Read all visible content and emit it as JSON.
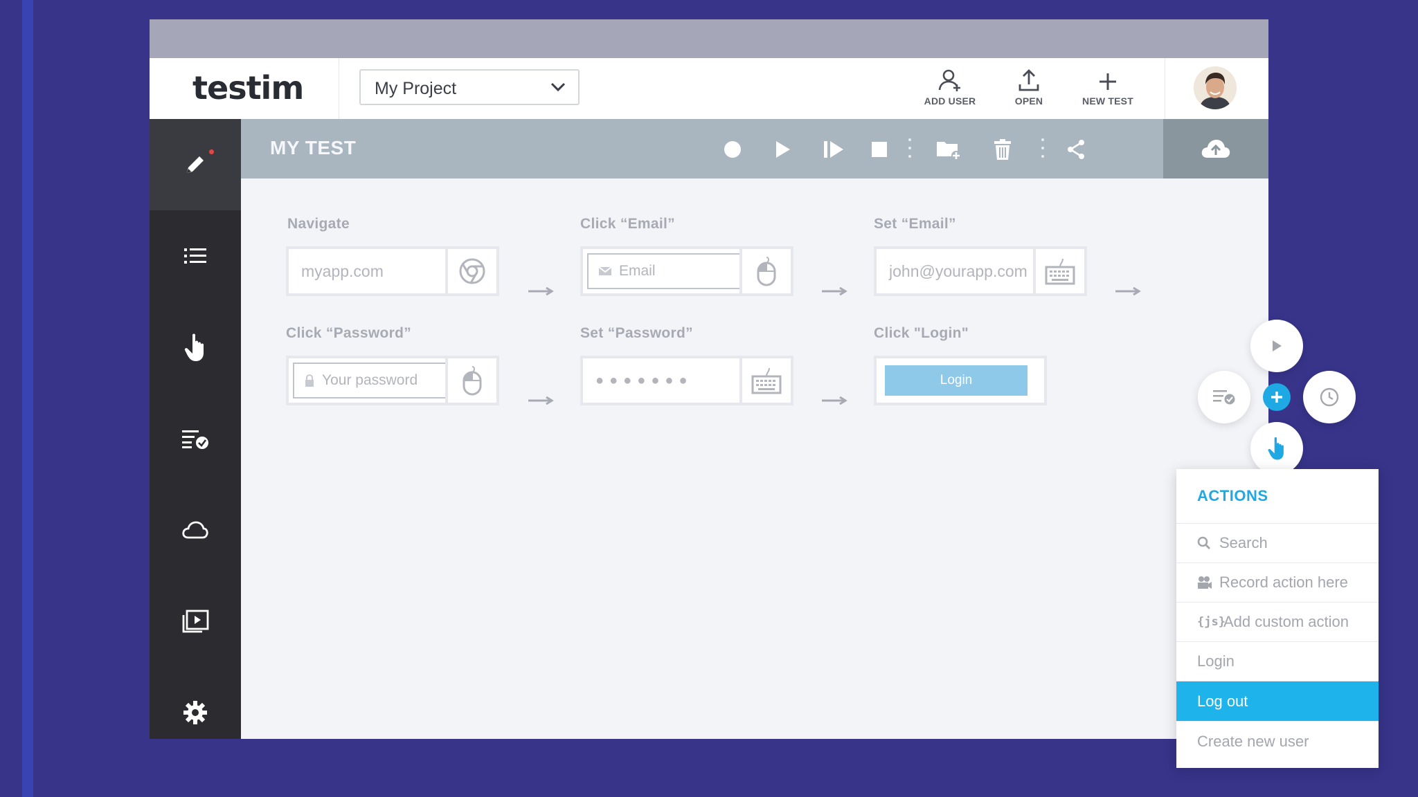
{
  "app": {
    "logo_text": "testi",
    "logo_m": "m",
    "project_select": {
      "value": "My Project"
    },
    "top_actions": [
      {
        "label": "ADD USER",
        "icon": "add-user-icon"
      },
      {
        "label": "OPEN",
        "icon": "upload-icon"
      },
      {
        "label": "NEW TEST",
        "icon": "plus-icon"
      }
    ],
    "avatar": "user-avatar"
  },
  "sidebar": {
    "items": [
      {
        "icon": "pencil-icon",
        "active": true
      },
      {
        "icon": "list-icon"
      },
      {
        "icon": "hand-pointer-icon"
      },
      {
        "icon": "checklist-icon"
      },
      {
        "icon": "cloud-icon"
      },
      {
        "icon": "playlist-icon"
      },
      {
        "icon": "gear-icon"
      }
    ]
  },
  "test": {
    "title": "MY TEST",
    "toolbar_icons": [
      "record-icon",
      "play-icon",
      "step-play-icon",
      "stop-icon",
      "add-folder-icon",
      "trash-icon",
      "share-icon",
      "cloud-upload-icon"
    ]
  },
  "steps": [
    {
      "label": "Navigate",
      "value": "myapp.com",
      "icon": "chrome-icon"
    },
    {
      "label": "Click “Email”",
      "value": "Email",
      "icon": "mouse-icon"
    },
    {
      "label": "Set “Email”",
      "value": "john@yourapp.com",
      "icon": "keyboard-icon"
    },
    {
      "label": "Click “Password”",
      "value": "Your password",
      "icon": "mouse-icon"
    },
    {
      "label": "Set “Password”",
      "value": "● ● ● ● ● ● ●",
      "icon": "keyboard-icon"
    },
    {
      "label": "Click \"Login\"",
      "value": "Login",
      "icon": "button"
    }
  ],
  "actions_menu": {
    "title": "ACTIONS",
    "search_placeholder": "Search",
    "items": [
      {
        "label": "Record action here",
        "icon": "record-action-icon"
      },
      {
        "label": "Add custom action",
        "icon": "js-icon",
        "icon_text": "{js}"
      },
      {
        "label": "Login"
      },
      {
        "label": "Log out",
        "selected": true
      },
      {
        "label": "Create new user"
      }
    ]
  },
  "colors": {
    "accent": "#1ea8e4",
    "selected": "#1eb3ea",
    "background": "#37348a",
    "sidebar": "#2b2b30",
    "testbar": "#a9b6c0"
  }
}
